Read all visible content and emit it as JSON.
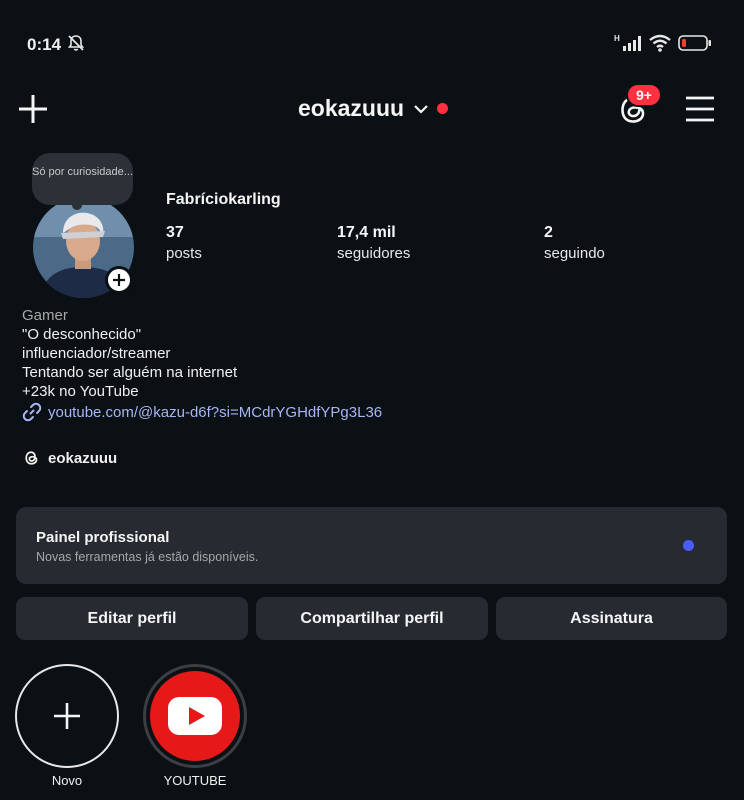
{
  "status_bar": {
    "time": "0:14",
    "icons": [
      "mute-icon",
      "signal-icon",
      "wifi-icon",
      "battery-icon"
    ],
    "battery_color": "#ff3b30"
  },
  "header": {
    "username": "eokazuuu",
    "threads_badge": "9+",
    "accent_red": "#ff3040"
  },
  "profile": {
    "note": "Só por curiosidade...",
    "display_name": "Fabríciokarling",
    "stats": [
      {
        "value": "37",
        "label": "posts"
      },
      {
        "value": "17,4 mil",
        "label": "seguidores"
      },
      {
        "value": "2",
        "label": "seguindo"
      }
    ]
  },
  "bio": {
    "category": "Gamer",
    "lines": [
      "\"O desconhecido\"",
      "influenciador/streamer",
      "Tentando ser alguém na internet",
      "+23k no YouTube"
    ],
    "link": "youtube.com/@kazu-d6f?si=MCdrYGHdfYPg3L36",
    "threads_handle": "eokazuuu"
  },
  "pro_panel": {
    "title": "Painel profissional",
    "subtitle": "Novas ferramentas já estão disponíveis.",
    "dot_color": "#4a5df9"
  },
  "actions": {
    "edit": "Editar perfil",
    "share": "Compartilhar perfil",
    "subscription": "Assinatura"
  },
  "highlights": [
    {
      "label": "Novo",
      "icon": "plus-icon"
    },
    {
      "label": "YOUTUBE",
      "icon": "youtube-icon"
    }
  ]
}
